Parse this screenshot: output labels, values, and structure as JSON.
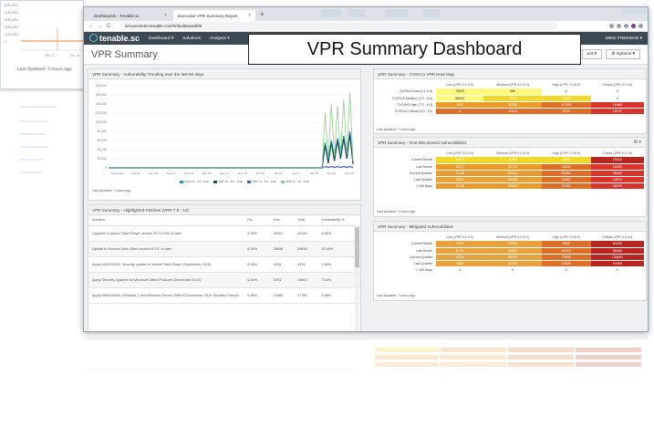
{
  "background_window": {
    "y_ticks": [
      "500,000",
      "400,000",
      "300,000",
      "200,000",
      "100,000",
      "0"
    ],
    "x_ticks": [
      "Mar 12",
      "Thu 15"
    ],
    "last_updated": "Last Updated: 3 hours ago"
  },
  "browser": {
    "tabs": [
      {
        "label": "Dashboards - Tenable.sc",
        "close": "×"
      },
      {
        "label": "Executive VPR Summary Report",
        "close": "×"
      }
    ],
    "new_tab": "+",
    "url": "securecenter.tenable.com/#/dashboard/09",
    "nav_back": "←",
    "nav_forward": "→",
    "nav_reload": "C"
  },
  "app": {
    "logo": "tenable.sc",
    "menus": [
      "Dashboard ▾",
      "Solutions",
      "Analysis ▾"
    ],
    "user": "MIKE FREEMAN ▾"
  },
  "page": {
    "title": "VPR Summary",
    "buttons": [
      "ent ▾",
      "⚙ Options ▾"
    ]
  },
  "overlay": {
    "caption": "VPR Summary Dashboard"
  },
  "trend_panel": {
    "title": "VPR Summary - Vulnerability Trending over the last 90 days",
    "last_updated": "Last Updated: 7 hours ago",
    "legend": [
      {
        "label": "VPR 0.0 - 3.9 - Total",
        "color": "#1c9aa8"
      },
      {
        "label": "VPR 4.0 - 6.9 - Total",
        "color": "#17505e"
      },
      {
        "label": "VPR 7.0 - 8.9 - Total",
        "color": "#4a5fa8"
      },
      {
        "label": "VPR 9.0 - 10 - Total",
        "color": "#8fcf8a"
      }
    ]
  },
  "chart_data": {
    "type": "line",
    "y_ticks": [
      "180,000",
      "160,000",
      "140,000",
      "120,000",
      "100,000",
      "80,000",
      "60,000",
      "40,000",
      "20,000",
      "0"
    ],
    "x_ticks": [
      "November",
      "Nov 09",
      "Nov 15",
      "Nov 23",
      "Dec 01",
      "Dec 09",
      "Dec 17",
      "Dec 25",
      "Jan 01",
      "Jan 09",
      "Jan 17",
      "Jan 25",
      "Feb 01",
      "Feb 09"
    ],
    "ylim": [
      0,
      180000
    ],
    "series": [
      {
        "name": "VPR 0.0 - 3.9 - Total",
        "color": "#1c9aa8",
        "values": [
          0,
          0,
          0,
          0,
          0,
          0,
          0,
          0,
          0,
          0,
          0,
          0,
          0,
          0,
          0,
          0,
          0,
          0,
          0,
          0,
          0,
          0,
          0,
          0,
          0,
          0,
          0,
          0,
          0,
          0,
          0,
          0,
          0,
          0,
          0,
          0,
          0,
          0,
          0,
          0,
          0,
          0,
          0,
          0,
          0,
          0,
          0,
          0,
          0,
          0,
          0,
          0,
          0,
          0,
          0,
          0,
          0,
          0,
          0,
          0,
          0,
          0,
          0,
          0,
          0,
          0,
          0,
          0,
          0,
          0,
          55000,
          15000,
          60000,
          20000,
          65000,
          30000,
          70000,
          25000,
          80000,
          10000
        ]
      },
      {
        "name": "VPR 4.0 - 6.9 - Total",
        "color": "#17505e",
        "values": [
          0,
          0,
          0,
          0,
          0,
          0,
          0,
          0,
          0,
          0,
          0,
          0,
          0,
          0,
          0,
          0,
          0,
          0,
          0,
          0,
          0,
          0,
          0,
          0,
          0,
          0,
          0,
          0,
          0,
          0,
          0,
          0,
          0,
          0,
          0,
          0,
          0,
          0,
          0,
          0,
          0,
          0,
          0,
          0,
          0,
          0,
          0,
          0,
          0,
          0,
          0,
          0,
          0,
          0,
          0,
          0,
          0,
          0,
          0,
          0,
          0,
          0,
          0,
          0,
          0,
          0,
          0,
          0,
          0,
          0,
          50000,
          10000,
          55000,
          15000,
          60000,
          20000,
          65000,
          20000,
          75000,
          8000
        ]
      },
      {
        "name": "VPR 7.0 - 8.9 - Total",
        "color": "#4a5fa8",
        "values": [
          0,
          0,
          0,
          0,
          0,
          0,
          0,
          0,
          0,
          0,
          0,
          0,
          0,
          0,
          0,
          0,
          0,
          0,
          0,
          0,
          0,
          0,
          0,
          0,
          0,
          0,
          0,
          0,
          0,
          0,
          0,
          0,
          0,
          0,
          0,
          0,
          0,
          0,
          0,
          0,
          0,
          0,
          0,
          0,
          0,
          0,
          0,
          0,
          0,
          0,
          0,
          0,
          0,
          0,
          0,
          0,
          0,
          0,
          0,
          0,
          0,
          0,
          0,
          0,
          0,
          0,
          0,
          0,
          0,
          0,
          3000,
          1000,
          3000,
          1000,
          3000,
          1000,
          3000,
          1000,
          3000,
          1000
        ]
      },
      {
        "name": "VPR 9.0 - 10 - Total",
        "color": "#8fcf8a",
        "values": [
          0,
          0,
          0,
          0,
          0,
          0,
          0,
          0,
          0,
          0,
          0,
          0,
          0,
          0,
          0,
          0,
          0,
          0,
          0,
          0,
          0,
          0,
          0,
          0,
          0,
          0,
          0,
          0,
          0,
          0,
          0,
          0,
          0,
          0,
          0,
          0,
          0,
          0,
          0,
          0,
          0,
          0,
          0,
          0,
          0,
          0,
          0,
          0,
          0,
          0,
          0,
          0,
          0,
          0,
          0,
          0,
          0,
          0,
          0,
          0,
          0,
          0,
          0,
          0,
          0,
          0,
          0,
          0,
          0,
          0,
          120000,
          20000,
          140000,
          25000,
          135000,
          30000,
          150000,
          30000,
          165000,
          15000
        ]
      }
    ]
  },
  "patch_panel": {
    "title": "VPR Summary - Highlighted Patches (VPR 7.0 - 10)",
    "columns": [
      "Solution",
      "Ra...",
      "Hos...",
      "Total",
      "Vulnerability %"
    ],
    "rows": [
      [
        "Upgrade to Adobe Flash Player version 32.0.0.330 or later",
        "9.55%",
        "25091",
        "24143",
        "6.86%"
      ],
      [
        "Update to Horizon View Client version 5.2.0, or later",
        "8.44%",
        "25658",
        "25658",
        "10.46%"
      ],
      [
        "Apply MS#190115: Security update for Adobe Flash Player (September 2019)",
        "8.06%",
        "4376",
        "4376",
        "2.68%"
      ],
      [
        "Apply Security Updates for Microsoft Office Products (December 2019)",
        "6.44%",
        "3093",
        "19803",
        "7.54%"
      ],
      [
        "Apply MS#200002: Windows 7 and Windows Server 2008 R2 December 2019 Security Cumula...",
        "5.96%",
        "13085",
        "17785",
        "6.98%"
      ]
    ]
  },
  "heatmap_panel": {
    "title": "VPR Summary - CVSS to VPR Heat Map",
    "columns": [
      "Low (VPR 0.0-3.9)",
      "Medium (VPR 4.0-6.9)",
      "High (VPR 7.0-8.9)",
      "Critical (VPR 9.0-10)"
    ],
    "rows": [
      {
        "label": "CVSSv3 Low (0.1-3.9)",
        "cells": [
          [
            "74942",
            "c-ly"
          ],
          [
            "986",
            "c-ly"
          ],
          [
            "0",
            "c-w"
          ],
          [
            "0",
            "c-w"
          ]
        ]
      },
      {
        "label": "CVSSv3 Medium (4.0 - 6.9)",
        "cells": [
          [
            "66834",
            "c-ly"
          ],
          [
            "7202",
            "c-y"
          ],
          [
            "2620",
            "c-y"
          ],
          [
            "0",
            "c-w"
          ]
        ]
      },
      {
        "label": "CVSSv3 High (7.0 - 8.9)",
        "cells": [
          [
            "1602",
            "c-o"
          ],
          [
            "30380",
            "c-o"
          ],
          [
            "107564",
            "c-do"
          ],
          [
            "16468",
            "c-r"
          ]
        ]
      },
      {
        "label": "CVSSv3 Critical (9.0 - 10)",
        "cells": [
          [
            "0",
            "c-do"
          ],
          [
            "40015",
            "c-do"
          ],
          [
            "5236",
            "c-do"
          ],
          [
            "18747",
            "c-r"
          ]
        ]
      }
    ],
    "last_updated": "Last Updated: 7 hours ago"
  },
  "first_discovered_panel": {
    "title": "VPR Summary - First Discovered Vulnerabilities",
    "columns": [
      "Low (VPR 0.0-3.9)",
      "Medium (VPR 4.0-6.9)",
      "High (VPR 7.0-8.9)",
      "Critical (VPR 9.0-10)"
    ],
    "rows": [
      {
        "label": "Current Month",
        "cells": [
          [
            "20009",
            "c-y"
          ],
          [
            "11684",
            "c-y"
          ],
          [
            "6898",
            "c-y"
          ],
          [
            "20534",
            "c-dr"
          ]
        ]
      },
      {
        "label": "Last Month",
        "cells": [
          [
            "18971",
            "c-o"
          ],
          [
            "62744",
            "c-o"
          ],
          [
            "18059",
            "c-do"
          ],
          [
            "18455",
            "c-r"
          ]
        ]
      },
      {
        "label": "Current Quarter",
        "cells": [
          [
            "37108",
            "c-o"
          ],
          [
            "150812",
            "c-o"
          ],
          [
            "83053",
            "c-do"
          ],
          [
            "38440",
            "c-r"
          ]
        ]
      },
      {
        "label": "Last Quarter",
        "cells": [
          [
            "9058",
            "c-o2"
          ],
          [
            "54155",
            "c-o2"
          ],
          [
            "16343",
            "c-do"
          ],
          [
            "10670",
            "c-r"
          ]
        ]
      },
      {
        "label": "> 180 Days",
        "cells": [
          [
            "47108",
            "c-o"
          ],
          [
            "109804",
            "c-o"
          ],
          [
            "31931",
            "c-do"
          ],
          [
            "38290",
            "c-r"
          ]
        ]
      }
    ],
    "last_updated": "Last Updated: 7 hours ago"
  },
  "mitigated_panel": {
    "title": "VPR Summary - Mitigated Vulnerabilities",
    "columns": [
      "Low (VPR 0.0-3.9)",
      "Medium (VPR 4.0-6.9)",
      "High (VPR 7.0-8.9)",
      "Critical (VPR 9.0-10)"
    ],
    "rows": [
      {
        "label": "Current Month",
        "cells": [
          [
            "4299",
            "c-o2"
          ],
          [
            "32962",
            "c-o2"
          ],
          [
            "5856",
            "c-do"
          ],
          [
            "63183",
            "c-dr"
          ]
        ]
      },
      {
        "label": "Last Month",
        "cells": [
          [
            "8176",
            "c-o2"
          ],
          [
            "26624",
            "c-o2"
          ],
          [
            "43376",
            "c-do"
          ],
          [
            "86668",
            "c-dr"
          ]
        ]
      },
      {
        "label": "Current Quarter",
        "cells": [
          [
            "13322",
            "c-o2"
          ],
          [
            "65470",
            "c-o2"
          ],
          [
            "73836",
            "c-do"
          ],
          [
            "138663",
            "c-dr"
          ]
        ]
      },
      {
        "label": "Last Quarter",
        "cells": [
          [
            "1286",
            "c-o2"
          ],
          [
            "20730",
            "c-o2"
          ],
          [
            "23826",
            "c-do"
          ],
          [
            "94469",
            "c-dr"
          ]
        ]
      },
      {
        "label": "> 180 Days",
        "cells": [
          [
            "0",
            "c-w"
          ],
          [
            "0",
            "c-w"
          ],
          [
            "0",
            "c-w"
          ],
          [
            "0",
            "c-w"
          ]
        ]
      }
    ],
    "last_updated": "Last Updated: 7 hours ago"
  },
  "gear_icon": "⚙ ▾"
}
